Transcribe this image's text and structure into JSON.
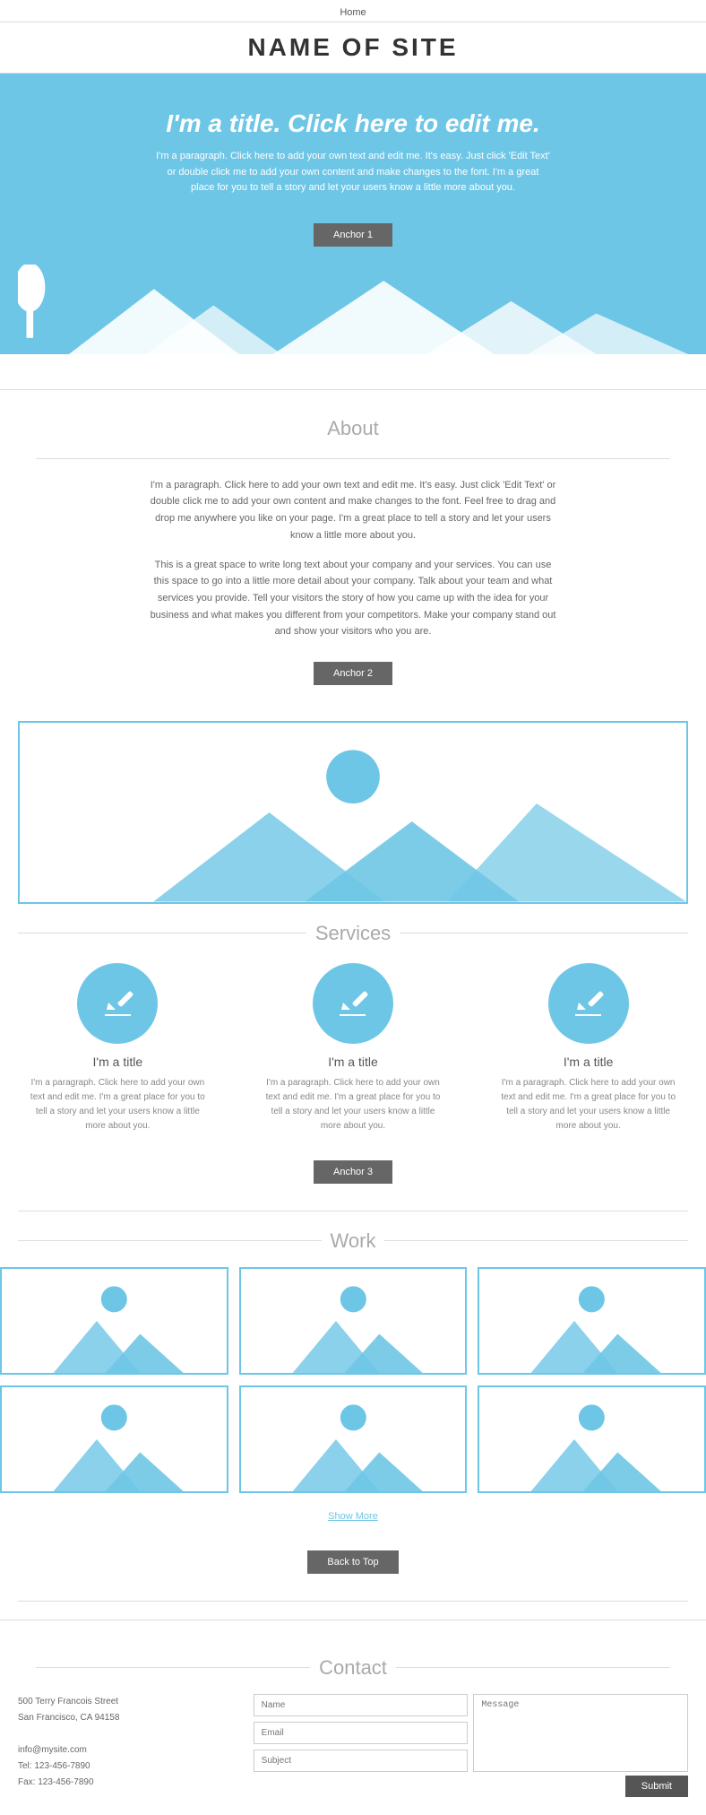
{
  "nav": {
    "home_label": "Home"
  },
  "header": {
    "site_title": "NAME OF SITE"
  },
  "hero": {
    "title": "I'm a title. Click here to edit me.",
    "paragraph": "I'm a paragraph. Click here to add your own text and edit me. It's easy. Just click 'Edit Text' or double click me to add your own content and make changes to the font. I'm a great place for you to tell a story and let your users know a little more about you.",
    "anchor_label": "Anchor 1"
  },
  "about": {
    "section_title": "About",
    "paragraph1": "I'm a paragraph. Click here to add your own text and edit me. It's easy. Just click 'Edit Text' or double click me to add your own content and make changes to the font. Feel free to drag and drop me anywhere you like on your page. I'm a great place to tell a story and let your users know a little more about you.",
    "paragraph2": "This is a great space to write long text about your company and your services. You can use this space to go into a little more detail about your company. Talk about your team and what services you provide. Tell your visitors the story of how you came up with the idea for your business and what makes you different from your competitors. Make your company stand out and show your visitors who you are.",
    "anchor_label": "Anchor 2"
  },
  "services": {
    "section_title": "Services",
    "items": [
      {
        "title": "I'm a title",
        "paragraph": "I'm a paragraph. Click here to add your own text and edit me. I'm a great place for you to tell a story and let your users know a little more about you."
      },
      {
        "title": "I'm a title",
        "paragraph": "I'm a paragraph. Click here to add your own text and edit me. I'm a great place for you to tell a story and let your users know a little more about you."
      },
      {
        "title": "I'm a title",
        "paragraph": "I'm a paragraph. Click here to add your own text and edit me. I'm a great place for you to tell a story and let your users know a little more about you."
      }
    ],
    "anchor_label": "Anchor 3"
  },
  "work": {
    "section_title": "Work",
    "show_more_label": "Show More",
    "back_to_top_label": "Back to Top"
  },
  "contact": {
    "section_title": "Contact",
    "address_line1": "500 Terry Francois Street",
    "address_line2": "San Francisco, CA 94158",
    "email": "info@mysite.com",
    "tel": "Tel: 123-456-7890",
    "fax": "Fax: 123-456-7890",
    "form": {
      "name_placeholder": "Name",
      "email_placeholder": "Email",
      "subject_placeholder": "Subject",
      "message_placeholder": "Message",
      "submit_label": "Submit"
    }
  },
  "colors": {
    "accent": "#6ec6e6",
    "dark_btn": "#666666",
    "text_light": "#aaaaaa",
    "text_mid": "#666666"
  }
}
